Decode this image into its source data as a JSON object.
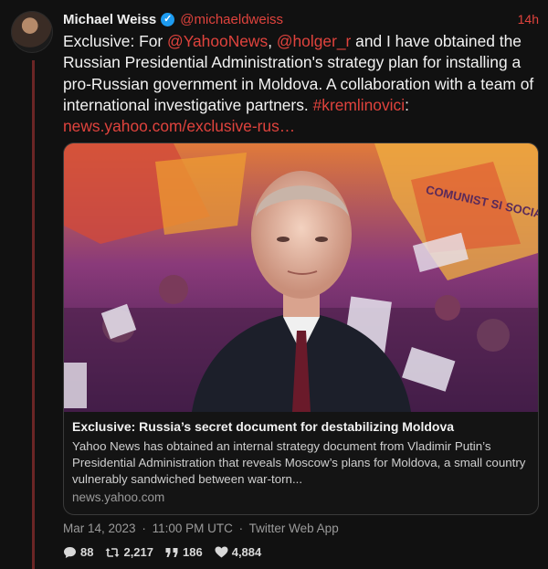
{
  "tweet": {
    "author_name": "Michael Weiss",
    "handle": "@michaeldweiss",
    "relative_time": "14h",
    "text_parts": [
      {
        "t": "Exclusive: For ",
        "link": false
      },
      {
        "t": "@YahooNews",
        "link": true
      },
      {
        "t": ", ",
        "link": false
      },
      {
        "t": "@holger_r",
        "link": true
      },
      {
        "t": " and I have obtained the Russian Presidential Administration's strategy plan for installing a pro-Russian government in Moldova. A collaboration with a team of international investigative partners. ",
        "link": false
      },
      {
        "t": "#kremlinovici",
        "link": true
      },
      {
        "t": ": ",
        "link": false
      },
      {
        "t": "news.yahoo.com/exclusive-rus…",
        "link": true
      }
    ],
    "date": "Mar 14, 2023",
    "clock": "11:00 PM UTC",
    "source": "Twitter Web App",
    "separator": "·"
  },
  "card": {
    "title": "Exclusive: Russia’s secret document for destabilizing Moldova",
    "description": "Yahoo News has obtained an internal strategy document from Vladimir Putin’s Presidential Administration that reveals Moscow’s plans for Moldova, a small country vulnerably sandwiched between war-torn...",
    "domain": "news.yahoo.com",
    "image_banner_text": "COMUNIST SI SOCIA"
  },
  "stats": {
    "replies": "88",
    "retweets": "2,217",
    "quotes": "186",
    "likes": "4,884"
  },
  "icons": {
    "verified": "verified-badge-icon",
    "reply": "speech-bubble-icon",
    "retweet": "retweet-arrows-icon",
    "quote": "quote-marks-icon",
    "like": "heart-icon"
  },
  "colors": {
    "background": "#111111",
    "accent": "#e0433d",
    "thread_line": "#6b2525",
    "verified": "#1d9bf0"
  }
}
